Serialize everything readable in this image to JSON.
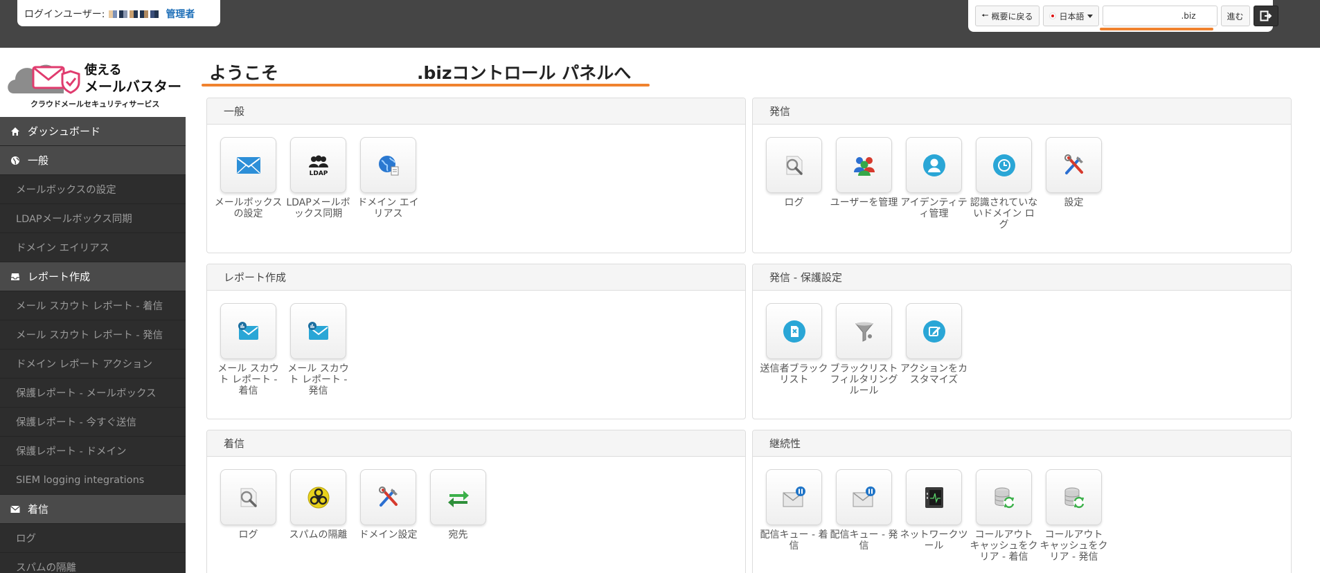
{
  "top": {
    "login_label": "ログインユーザー:",
    "login_role": "管理者",
    "back_label": "概要に戻る",
    "language": "日本語",
    "domain_value": ".biz",
    "go_label": "進む"
  },
  "logo": {
    "line1": "使える",
    "line2": "メールバスター",
    "tagline": "クラウドメールセキュリティサービス"
  },
  "welcome": {
    "part1": "ようこそ",
    "part2": ".bizコントロール パネルへ"
  },
  "sidebar": {
    "items": [
      {
        "label": "ダッシュボード"
      },
      {
        "label": "一般"
      },
      {
        "label": "メールボックスの設定"
      },
      {
        "label": "LDAPメールボックス同期"
      },
      {
        "label": "ドメイン エイリアス"
      },
      {
        "label": "レポート作成"
      },
      {
        "label": "メール スカウト レポート - 着信"
      },
      {
        "label": "メール スカウト レポート - 発信"
      },
      {
        "label": "ドメイン レポート アクション"
      },
      {
        "label": "保護レポート - メールボックス"
      },
      {
        "label": "保護レポート - 今すぐ送信"
      },
      {
        "label": "保護レポート - ドメイン"
      },
      {
        "label": "SIEM logging integrations"
      },
      {
        "label": "着信"
      },
      {
        "label": "ログ"
      },
      {
        "label": "スパムの隔離"
      }
    ]
  },
  "panels": {
    "general": {
      "title": "一般",
      "tiles": [
        {
          "label": "メールボックスの設定"
        },
        {
          "label": "LDAPメールボックス同期"
        },
        {
          "label": "ドメイン エイリアス"
        }
      ]
    },
    "outgoing": {
      "title": "発信",
      "tiles": [
        {
          "label": "ログ"
        },
        {
          "label": "ユーザーを管理"
        },
        {
          "label": "アイデンティティ管理"
        },
        {
          "label": "認識されていないドメイン ログ"
        },
        {
          "label": "設定"
        }
      ]
    },
    "reports": {
      "title": "レポート作成",
      "tiles": [
        {
          "label": "メール スカウト レポート - 着信"
        },
        {
          "label": "メール スカウト レポート - 発信"
        }
      ]
    },
    "outgoing_protection": {
      "title": "発信 - 保護設定",
      "tiles": [
        {
          "label": "送信者ブラックリスト"
        },
        {
          "label": "ブラックリスト フィルタリング ルール"
        },
        {
          "label": "アクションをカスタマイズ"
        }
      ]
    },
    "incoming": {
      "title": "着信",
      "tiles": [
        {
          "label": "ログ"
        },
        {
          "label": "スパムの隔離"
        },
        {
          "label": "ドメイン設定"
        },
        {
          "label": "宛先"
        }
      ]
    },
    "continuity": {
      "title": "継続性",
      "tiles": [
        {
          "label": "配信キュー - 着信"
        },
        {
          "label": "配信キュー - 発信"
        },
        {
          "label": "ネットワークツール"
        },
        {
          "label": "コールアウト キャッシュをクリア - 着信"
        },
        {
          "label": "コールアウト キャッシュをクリア - 発信"
        }
      ]
    }
  },
  "colors": {
    "accent_orange": "#f0822f",
    "topbar": "#454545",
    "sidebar_dark": "#2d2d2d",
    "sidebar_head": "#4a4a4a",
    "link_blue": "#1e6fb8"
  }
}
